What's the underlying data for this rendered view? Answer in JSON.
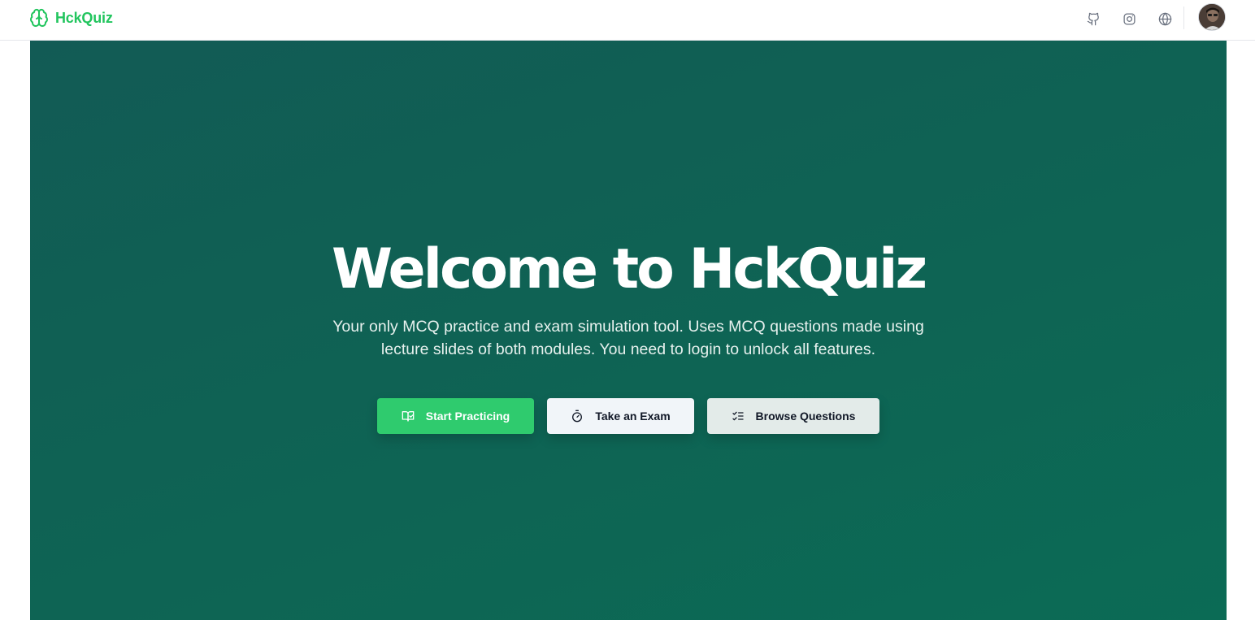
{
  "nav": {
    "brand": "HckQuiz",
    "icons": [
      "github-icon",
      "instagram-icon",
      "globe-icon"
    ]
  },
  "hero": {
    "title": "Welcome to HckQuiz",
    "subtitle": "Your only MCQ practice and exam simulation tool. Uses MCQ questions made using lecture slides of both modules. You need to login to unlock all features.",
    "buttons": {
      "practice": "Start Practicing",
      "exam": "Take an Exam",
      "browse": "Browse Questions"
    }
  },
  "colors": {
    "accent": "#22c55e",
    "hero_start": "#125b55",
    "hero_end": "#0b6b55",
    "primary_button": "#2fcb6e"
  }
}
